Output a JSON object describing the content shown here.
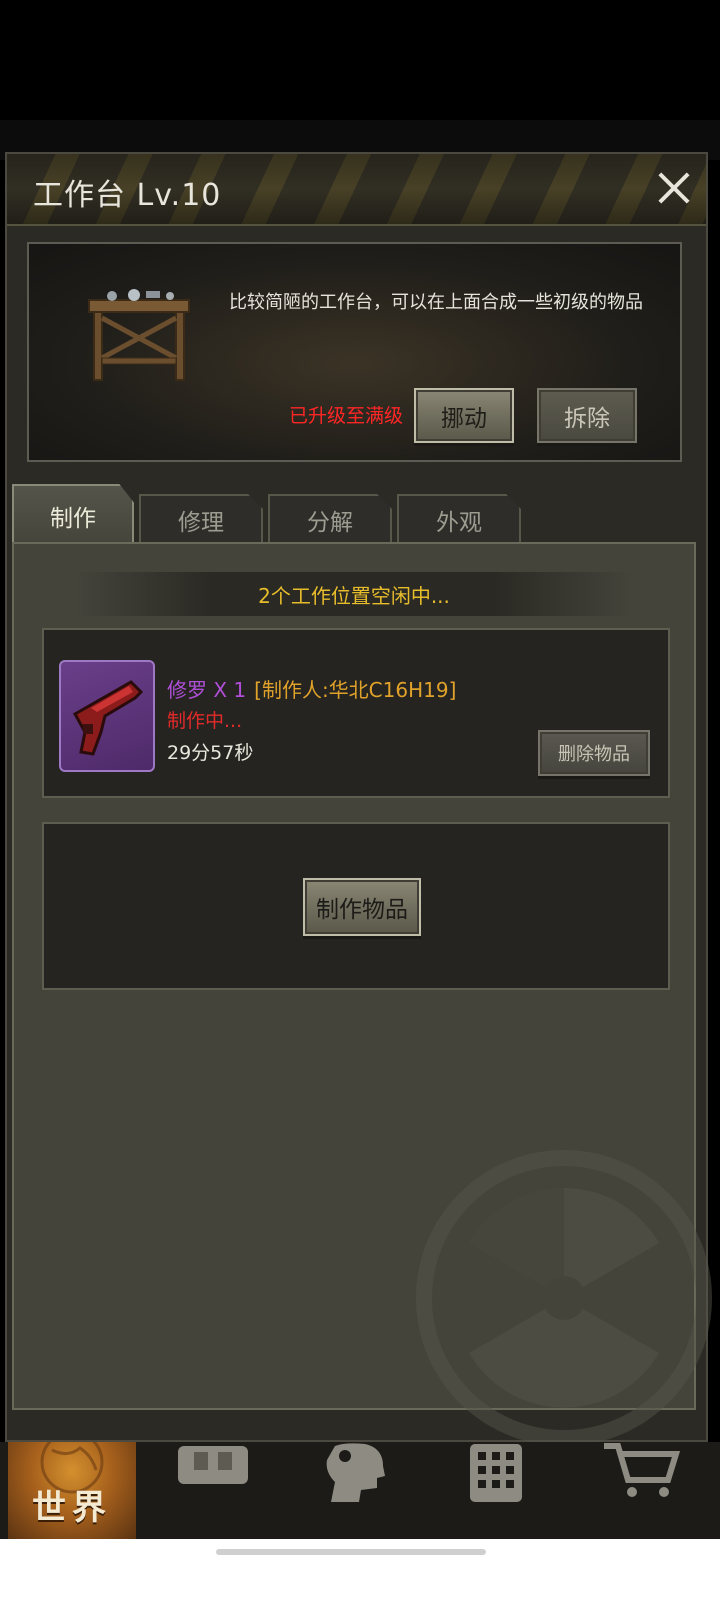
{
  "modal": {
    "title": "工作台 Lv.10"
  },
  "info": {
    "description": "比较简陋的工作台，可以在上面合成一些初级的物品",
    "max_level_text": "已升级至满级",
    "move_label": "挪动",
    "demolish_label": "拆除"
  },
  "tabs": [
    {
      "label": "制作",
      "active": true
    },
    {
      "label": "修理",
      "active": false
    },
    {
      "label": "分解",
      "active": false
    },
    {
      "label": "外观",
      "active": false
    }
  ],
  "craft": {
    "slot_status": "2个工作位置空闲中...",
    "item": {
      "name": "修罗 X 1",
      "maker": "[制作人:华北C16H19]",
      "state": "制作中...",
      "time_left": "29分57秒",
      "delete_label": "删除物品"
    },
    "craft_button_label": "制作物品"
  },
  "nav": {
    "world_label": "世界",
    "items": [
      "world-icon",
      "backpack-icon",
      "character-icon",
      "phone-icon",
      "shop-cart-icon"
    ]
  },
  "colors": {
    "rarity_purple": "#b04ed8",
    "maker_gold": "#e0a22a",
    "warning_red": "#ff2626",
    "status_gold": "#e7bd2c"
  }
}
